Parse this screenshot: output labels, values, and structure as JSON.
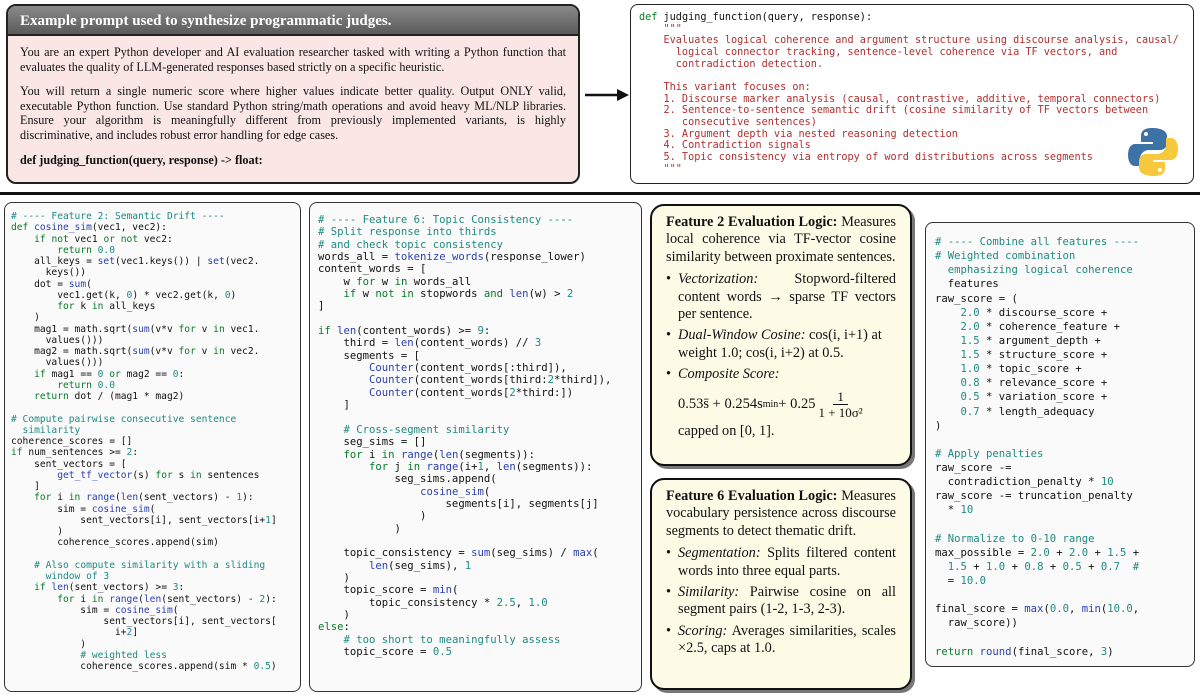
{
  "prompt": {
    "title": "Example prompt used to synthesize programmatic judges.",
    "paragraph1": "You are an expert Python developer and AI evaluation researcher tasked with writing a Python function that evaluates the quality of LLM-generated responses based strictly on a specific heuristic.",
    "paragraph2": "You will return a single numeric score where higher values indicate better quality.  Output ONLY valid, executable Python function.  Use standard Python string/math operations and avoid heavy ML/NLP libraries.  Ensure your algorithm is meaningfully different from previously implemented variants, is highly discriminative, and includes robust error handling for edge cases.",
    "signature": "def judging_function(query, response) -> float:"
  },
  "function_preview": {
    "def_keyword": "def",
    "signature": " judging_function(query, response):",
    "docstring": [
      "    \"\"\"",
      "    Evaluates logical coherence and argument structure using discourse analysis, causal/",
      "      logical connector tracking, sentence-level coherence via TF vectors, and",
      "      contradiction detection.",
      "",
      "    This variant focuses on:",
      "    1. Discourse marker analysis (causal, contrastive, additive, temporal connectors)",
      "    2. Sentence-to-sentence semantic drift (cosine similarity of TF vectors between",
      "       consecutive sentences)",
      "    3. Argument depth via nested reasoning detection",
      "    4. Contradiction signals",
      "    5. Topic consistency via entropy of word distributions across segments",
      "    \"\"\""
    ]
  },
  "logo": "python-logo",
  "feature2_code": [
    "# ---- Feature 2: Semantic Drift ----",
    "def cosine_sim(vec1, vec2):",
    "    if not vec1 or not vec2:",
    "        return 0.0",
    "    all_keys = set(vec1.keys()) | set(vec2.",
    "      keys())",
    "    dot = sum(",
    "        vec1.get(k, 0) * vec2.get(k, 0)",
    "        for k in all_keys",
    "    )",
    "    mag1 = math.sqrt(sum(v*v for v in vec1.",
    "      values()))",
    "    mag2 = math.sqrt(sum(v*v for v in vec2.",
    "      values()))",
    "    if mag1 == 0 or mag2 == 0:",
    "        return 0.0",
    "    return dot / (mag1 * mag2)",
    "",
    "# Compute pairwise consecutive sentence",
    "  similarity",
    "coherence_scores = []",
    "if num_sentences >= 2:",
    "    sent_vectors = [",
    "        get_tf_vector(s) for s in sentences",
    "    ]",
    "    for i in range(len(sent_vectors) - 1):",
    "        sim = cosine_sim(",
    "            sent_vectors[i], sent_vectors[i+1]",
    "        )",
    "        coherence_scores.append(sim)",
    "",
    "    # Also compute similarity with a sliding",
    "      window of 3",
    "    if len(sent_vectors) >= 3:",
    "        for i in range(len(sent_vectors) - 2):",
    "            sim = cosine_sim(",
    "                sent_vectors[i], sent_vectors[",
    "                  i+2]",
    "            )",
    "            # weighted less",
    "            coherence_scores.append(sim * 0.5)"
  ],
  "feature6_code": [
    "# ---- Feature 6: Topic Consistency ----",
    "# Split response into thirds",
    "# and check topic consistency",
    "words_all = tokenize_words(response_lower)",
    "content_words = [",
    "    w for w in words_all",
    "    if w not in stopwords and len(w) > 2",
    "]",
    "",
    "if len(content_words) >= 9:",
    "    third = len(content_words) // 3",
    "    segments = [",
    "        Counter(content_words[:third]),",
    "        Counter(content_words[third:2*third]),",
    "        Counter(content_words[2*third:])",
    "    ]",
    "",
    "    # Cross-segment similarity",
    "    seg_sims = []",
    "    for i in range(len(segments)):",
    "        for j in range(i+1, len(segments)):",
    "            seg_sims.append(",
    "                cosine_sim(",
    "                    segments[i], segments[j]",
    "                )",
    "            )",
    "",
    "    topic_consistency = sum(seg_sims) / max(",
    "        len(seg_sims), 1",
    "    )",
    "    topic_score = min(",
    "        topic_consistency * 2.5, 1.0",
    "    )",
    "else:",
    "    # too short to meaningfully assess",
    "    topic_score = 0.5"
  ],
  "combine_code": [
    "# ---- Combine all features ----",
    "# Weighted combination",
    "  emphasizing logical coherence",
    "  features",
    "raw_score = (",
    "    2.0 * discourse_score +",
    "    2.0 * coherence_feature +",
    "    1.5 * argument_depth +",
    "    1.5 * structure_score +",
    "    1.0 * topic_score +",
    "    0.8 * relevance_score +",
    "    0.5 * variation_score +",
    "    0.7 * length_adequacy",
    ")",
    "",
    "# Apply penalties",
    "raw_score -=",
    "  contradiction_penalty * 10",
    "raw_score -= truncation_penalty",
    "  * 10",
    "",
    "# Normalize to 0-10 range",
    "max_possible = 2.0 + 2.0 + 1.5 +",
    "  1.5 + 1.0 + 0.8 + 0.5 + 0.7  #",
    "  = 10.0",
    "",
    "final_score = max(0.0, min(10.0,",
    "  raw_score))",
    "",
    "return round(final_score, 3)"
  ],
  "logic1": {
    "heading": "Feature 2 Evaluation Logic:",
    "intro": " Measures local coherence via TF-vector cosine similarity between proximate sentences.",
    "b1_label": "Vectorization:",
    "b1_text": " Stopword-filtered content words → sparse TF vectors per sentence.",
    "b2_label": "Dual-Window Cosine:",
    "b2_text": " cos(i, i+1) at weight 1.0; cos(i, i+2) at 0.5.",
    "b3_label": "Composite Score:",
    "formula_main": "0.53s̄ + 0.254s",
    "formula_sub": "min",
    "formula_plus": " + 0.25",
    "formula_num": "1",
    "formula_den": "1 + 10σ²",
    "capped": "capped on [0, 1]."
  },
  "logic2": {
    "heading": "Feature 6 Evaluation Logic:",
    "intro": " Measures vocabulary persistence across discourse segments to detect thematic drift.",
    "b1_label": "Segmentation:",
    "b1_text": " Splits filtered content words into three equal parts.",
    "b2_label": "Similarity:",
    "b2_text": " Pairwise cosine on all segment pairs (1-2, 1-3, 2-3).",
    "b3_label": "Scoring:",
    "b3_text": " Averages similarities, scales ×2.5, caps at 1.0."
  }
}
